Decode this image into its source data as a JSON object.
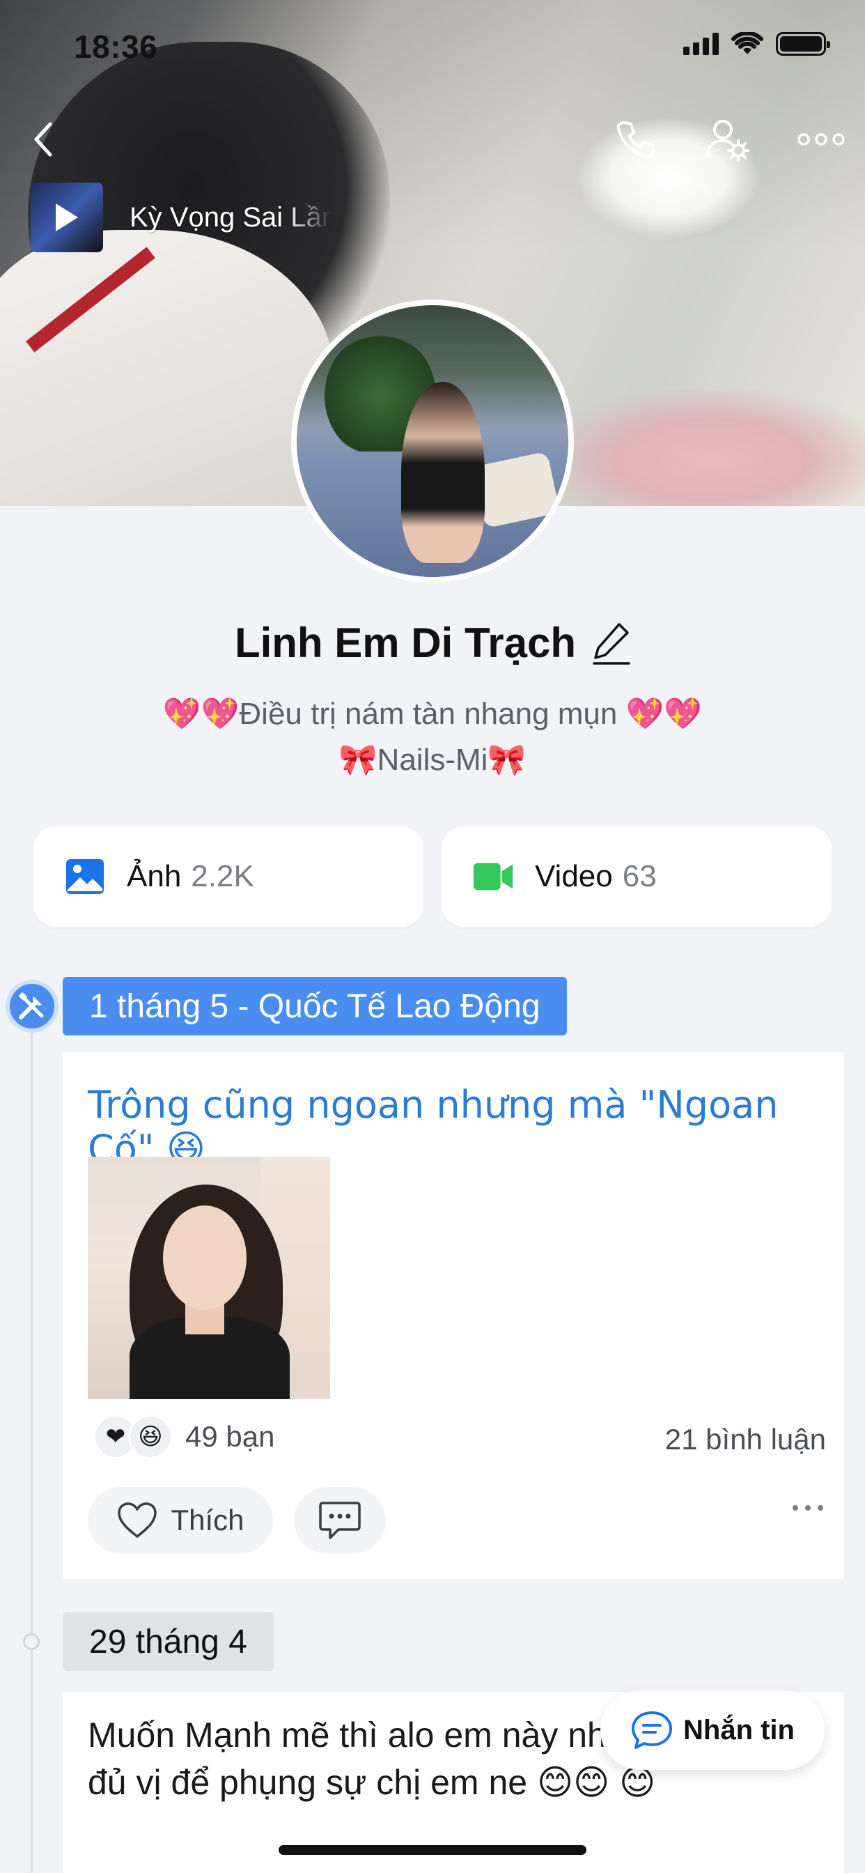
{
  "status": {
    "time": "18:36"
  },
  "music": {
    "title": "Kỳ Vọng Sai Lầm"
  },
  "profile": {
    "name": "Linh Em Di Trạch",
    "bio_line1": "💖💖Điều trị nám tàn nhang mụn 💖💖",
    "bio_line2": "🎀Nails-Mi🎀"
  },
  "media": {
    "photos": {
      "label": "Ảnh",
      "count": "2.2K"
    },
    "videos": {
      "label": "Video",
      "count": "63"
    }
  },
  "timeline": {
    "tag": "1 tháng 5 - Quốc Tế Lao Động",
    "date2": "29 tháng 4"
  },
  "post1": {
    "title": "Trông cũng ngoan nhưng mà \"Ngoan Cố\" 😆",
    "reactions": "49 bạn",
    "comments": "21 bình luận",
    "like_label": "Thích"
  },
  "post2": {
    "text": "Muốn Mạnh mẽ thì alo em này nhé E Linh Có đủ vị để phụng sự chị em ne 😊😊 😊"
  },
  "message_button": {
    "label": "Nhắn tin"
  },
  "colors": {
    "accent": "#4a8df0",
    "link": "#2b7bd3",
    "video_green": "#34c759"
  }
}
